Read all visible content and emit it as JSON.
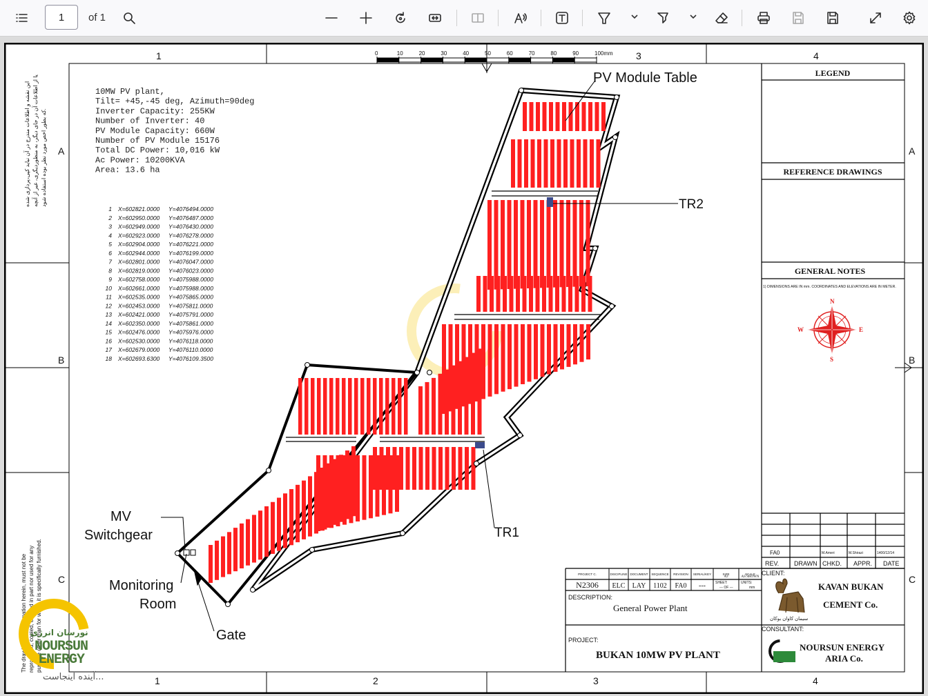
{
  "toolbar": {
    "page_number": "1",
    "page_count": "of 1",
    "icons": [
      "sidebar-toggle-icon",
      "search-icon",
      "zoom-out-icon",
      "zoom-in-icon",
      "rotate-icon",
      "fit-page-icon",
      "two-page-icon",
      "read-aloud-icon",
      "text-box-icon",
      "draw-icon",
      "highlight-icon",
      "eraser-icon",
      "print-icon",
      "save-icon",
      "save-as-icon",
      "expand-icon",
      "settings-icon"
    ]
  },
  "drawing": {
    "grid_top": [
      "1",
      "3",
      "4"
    ],
    "grid_bottom": [
      "1",
      "2",
      "3",
      "4"
    ],
    "grid_rows": [
      "A",
      "B",
      "C"
    ],
    "scale_ticks": [
      "0",
      "10",
      "20",
      "30",
      "40",
      "50",
      "60",
      "70",
      "80",
      "90",
      "100mm"
    ],
    "plant_info": [
      "10MW  PV  plant,",
      "Tilt=  +45,-45  deg,  Azimuth=90deg",
      "Inverter  Capacity:  255KW",
      "Number  of  Inverter:  40",
      "PV  Module  Capacity:  660W",
      "Number  of  PV  Module  15176",
      "Total  DC  Power:  10,016  kW",
      "Ac  Power:    10200KVA",
      "Area:  13.6  ha"
    ],
    "coordinates": [
      [
        "1",
        "X=602821.0000",
        "Y=4076494.0000"
      ],
      [
        "2",
        "X=602950.0000",
        "Y=4076487.0000"
      ],
      [
        "3",
        "X=602949.0000",
        "Y=4076430.0000"
      ],
      [
        "4",
        "X=602923.0000",
        "Y=4076278.0000"
      ],
      [
        "5",
        "X=602904.0000",
        "Y=4076221.0000"
      ],
      [
        "6",
        "X=602944.0000",
        "Y=4076199.0000"
      ],
      [
        "7",
        "X=602801.0000",
        "Y=4076047.0000"
      ],
      [
        "8",
        "X=602819.0000",
        "Y=4076023.0000"
      ],
      [
        "9",
        "X=602758.0000",
        "Y=4075988.0000"
      ],
      [
        "10",
        "X=602661.0000",
        "Y=4075988.0000"
      ],
      [
        "11",
        "X=602535.0000",
        "Y=4075865.0000"
      ],
      [
        "12",
        "X=602453.0000",
        "Y=4075811.0000"
      ],
      [
        "13",
        "X=602421.0000",
        "Y=4075791.0000"
      ],
      [
        "14",
        "X=602350.0000",
        "Y=4075861.0000"
      ],
      [
        "15",
        "X=602476.0000",
        "Y=4075976.0000"
      ],
      [
        "16",
        "X=602530.0000",
        "Y=4076118.0000"
      ],
      [
        "17",
        "X=602679.0000",
        "Y=4076110.0000"
      ],
      [
        "18",
        "X=602693.6300",
        "Y=4076109.3500"
      ]
    ],
    "callouts": {
      "pv_table": "PV Module Table",
      "tr2": "TR2",
      "tr1": "TR1",
      "mv_line1": "MV",
      "mv_line2": "Switchgear",
      "mon_line1": "Monitoring",
      "mon_line2": "Room",
      "gate": "Gate"
    },
    "legend_title": "LEGEND",
    "reference_title": "REFERENCE  DRAWINGS",
    "notes_title": "GENERAL  NOTES",
    "note_1": "1) DIMENSIONS ARE IN mm. COORDINATES AND ELEVATIONS ARE IN METER.",
    "compass": [
      "N",
      "E",
      "S",
      "W"
    ],
    "rev_row": [
      "FA0",
      "",
      "M.Ameri",
      "M.Shirazi",
      "1400/12/14"
    ],
    "rev_headers": [
      "REV.",
      "DRAWN",
      "CHKD.",
      "APPR.",
      "DATE"
    ],
    "title_block": {
      "code_headers": [
        "PROJECT C.",
        "DISCIPLINE",
        "DOCUMENT",
        "SEQUENCE",
        "REVISION",
        "SERIAL/KEY",
        "SIZE",
        "SCALE"
      ],
      "code_values": [
        "N2306",
        "ELC",
        "LAY",
        "1102",
        "FA0",
        "---",
        "A3",
        "AS SHOWN"
      ],
      "sheet_label": "SHEET:",
      "sheet_value": "--- OF ---",
      "units_label": "UNITS:",
      "units_value": "mm",
      "description_label": "DESCRIPTION:",
      "description": "General  Power  Plant",
      "project_label": "PROJECT:",
      "project": "BUKAN  10MW  PV  PLANT",
      "client_label": "CLIENT:",
      "client_line1": "KAVAN  BUKAN",
      "client_line2": "CEMENT  Co.",
      "client_fa": "سیمان کاوان بوکان",
      "consultant_label": "CONSULTANT:",
      "consultant_line1": "NOURSUN  ENERGY",
      "consultant_line2": "ARIA  Co."
    },
    "side_note_fa": [
      "این نقشه و اطلاعات مندرج در آن نباید کپی،پردازی شده",
      "یا از اطلاعات آن در جای دیگر، به منظوردیگری، غیر از آنچه",
      "که بطور اخص مورد نظر بوده استفاده شود."
    ],
    "side_note_en": [
      "The drawing and information herein, must not be",
      "reproduced, copied, or used in part nor used for any",
      "purpose other than for which it is specifically furnished."
    ],
    "watermark": {
      "line1": "NOURSUN",
      "line2": "ENERGY",
      "fa_brand": "نورسان انرژی",
      "tagline": "آینده اینجاست..."
    },
    "colors": {
      "pv": "#ff2020",
      "line": "#000000",
      "accent": "#f5c400"
    }
  }
}
